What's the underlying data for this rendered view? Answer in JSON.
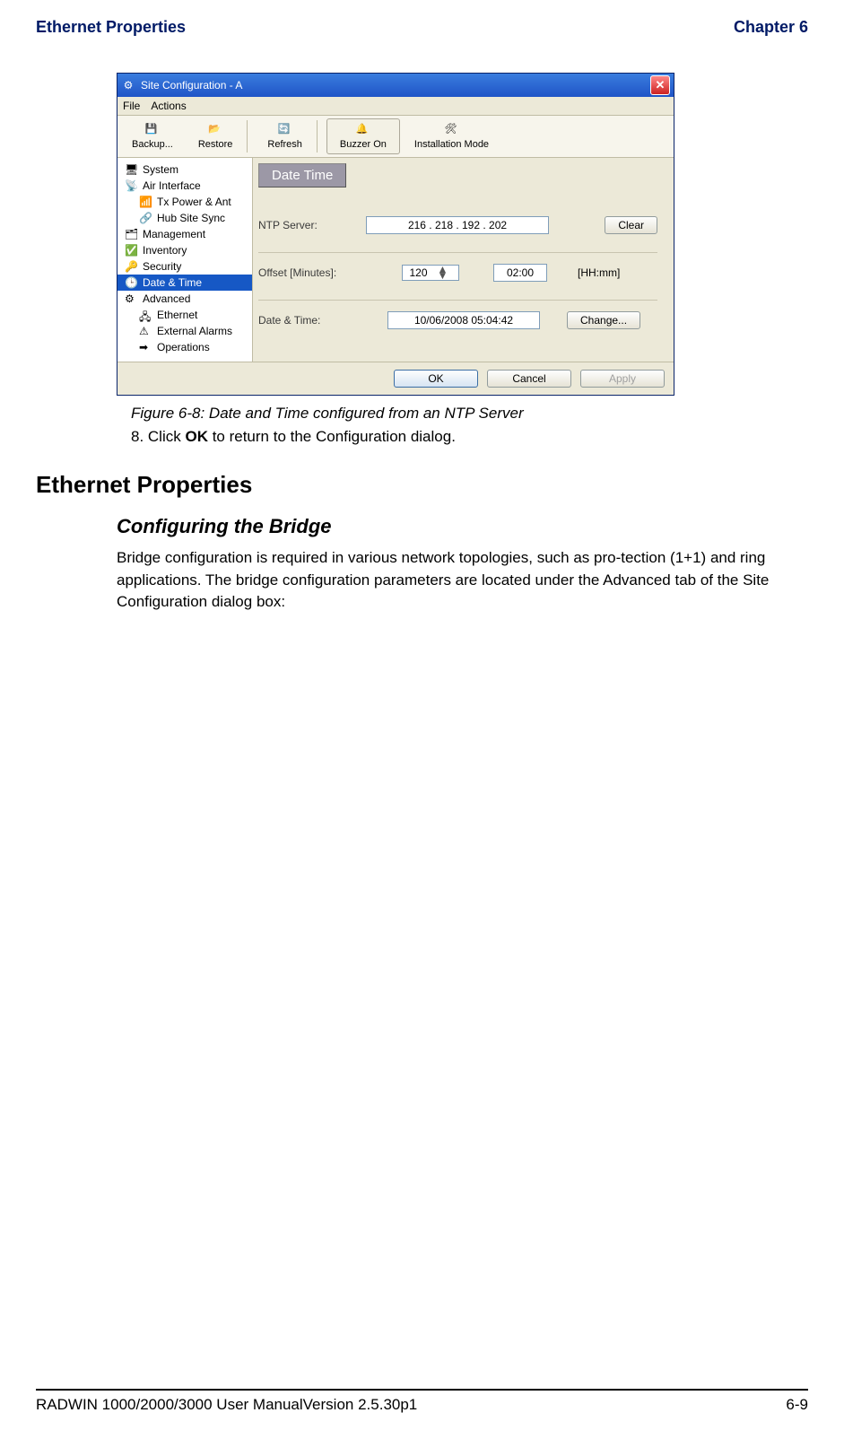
{
  "header": {
    "left": "Ethernet Properties",
    "right": "Chapter 6"
  },
  "window": {
    "title": "Site Configuration - A",
    "menu": {
      "file": "File",
      "actions": "Actions"
    },
    "toolbar": {
      "backup": "Backup...",
      "restore": "Restore",
      "refresh": "Refresh",
      "buzzer": "Buzzer On",
      "install": "Installation Mode"
    },
    "sidebar": {
      "items": [
        {
          "label": "System"
        },
        {
          "label": "Air Interface"
        },
        {
          "label": "Tx Power & Ant"
        },
        {
          "label": "Hub Site Sync"
        },
        {
          "label": "Management"
        },
        {
          "label": "Inventory"
        },
        {
          "label": "Security"
        },
        {
          "label": "Date & Time"
        },
        {
          "label": "Advanced"
        },
        {
          "label": "Ethernet"
        },
        {
          "label": "External Alarms"
        },
        {
          "label": "Operations"
        }
      ]
    },
    "section_title": "Date  Time",
    "ntp": {
      "label": "NTP Server:",
      "value": "216  . 218 . 192 .  202",
      "clear": "Clear"
    },
    "offset": {
      "label": "Offset [Minutes]:",
      "value": "120",
      "hhmm": "02:00",
      "unit": "[HH:mm]"
    },
    "datetime": {
      "label": "Date & Time:",
      "value": "10/06/2008 05:04:42",
      "change": "Change..."
    },
    "buttons": {
      "ok": "OK",
      "cancel": "Cancel",
      "apply": "Apply"
    }
  },
  "caption": "Figure 6-8: Date and Time configured from an NTP Server",
  "step": {
    "num": "8. ",
    "pre": "Click ",
    "bold": "OK",
    "post": " to return to the Configuration dialog."
  },
  "h1": "Ethernet Properties",
  "h2": "Configuring the Bridge",
  "paragraph": "Bridge configuration is required in various network topologies, such as pro-tection (1+1) and ring applications. The bridge configuration parameters are located under the Advanced tab of the Site Configuration dialog box:",
  "footer": {
    "left": "RADWIN 1000/2000/3000 User ManualVersion  2.5.30p1",
    "right": "6-9"
  },
  "icons": {
    "app": "⚙",
    "close": "✕",
    "disk": "💾",
    "restore": "📂",
    "refresh": "🔄",
    "buzzer": "🔔",
    "install": "🛠",
    "system": "🖥",
    "air": "📡",
    "tx": "📶",
    "hub": "🔗",
    "mgmt": "🗂",
    "inv": "✅",
    "sec": "🔑",
    "date": "🕒",
    "adv": "⚙",
    "eth": "🖧",
    "alarm": "⚠",
    "ops": "➡"
  }
}
